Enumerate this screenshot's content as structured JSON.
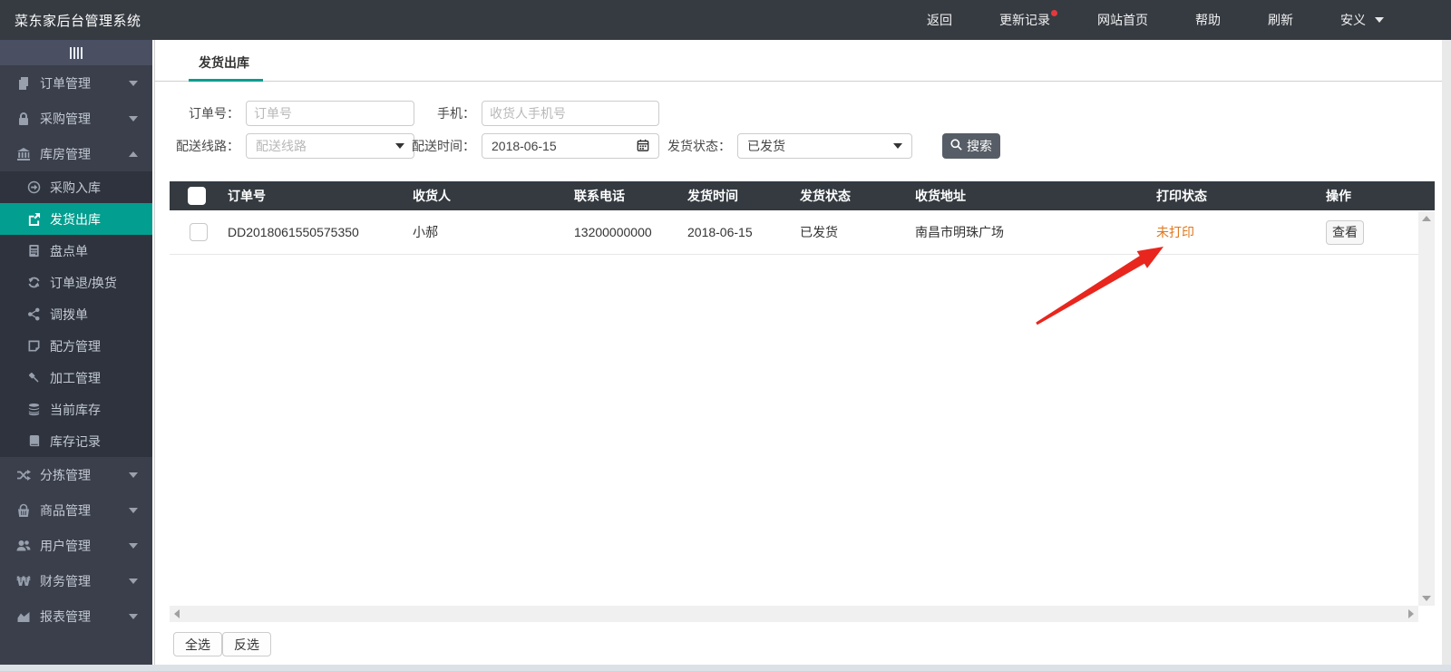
{
  "topbar": {
    "title": "菜东家后台管理系统",
    "nav": {
      "back": "返回",
      "updates": "更新记录",
      "site_home": "网站首页",
      "help": "帮助",
      "refresh": "刷新",
      "user": "安义"
    }
  },
  "sidebar": {
    "items": [
      {
        "label": "订单管理",
        "icon": "files-icon",
        "expanded": false
      },
      {
        "label": "采购管理",
        "icon": "lock-icon",
        "expanded": false
      },
      {
        "label": "库房管理",
        "icon": "bank-icon",
        "expanded": true,
        "children": [
          {
            "label": "采购入库",
            "icon": "sign-in-icon",
            "active": false
          },
          {
            "label": "发货出库",
            "icon": "export-icon",
            "active": true
          },
          {
            "label": "盘点单",
            "icon": "calculator-icon",
            "active": false
          },
          {
            "label": "订单退/换货",
            "icon": "refresh-icon",
            "active": false
          },
          {
            "label": "调拨单",
            "icon": "share-icon",
            "active": false
          },
          {
            "label": "配方管理",
            "icon": "note-icon",
            "active": false
          },
          {
            "label": "加工管理",
            "icon": "gavel-icon",
            "active": false
          },
          {
            "label": "当前库存",
            "icon": "database-icon",
            "active": false
          },
          {
            "label": "库存记录",
            "icon": "book-icon",
            "active": false
          }
        ]
      },
      {
        "label": "分拣管理",
        "icon": "shuffle-icon",
        "expanded": false
      },
      {
        "label": "商品管理",
        "icon": "basket-icon",
        "expanded": false
      },
      {
        "label": "用户管理",
        "icon": "users-icon",
        "expanded": false
      },
      {
        "label": "财务管理",
        "icon": "won-icon",
        "expanded": false
      },
      {
        "label": "报表管理",
        "icon": "area-chart-icon",
        "expanded": false
      }
    ]
  },
  "tabs": {
    "active": "发货出库"
  },
  "filters": {
    "order_no_label": "订单号：",
    "order_no_placeholder": "订单号",
    "phone_label": "手机：",
    "phone_placeholder": "收货人手机号",
    "route_label": "配送线路：",
    "route_value": "配送线路",
    "date_label": "配送时间：",
    "date_value": "2018-06-15",
    "status_label": "发货状态：",
    "status_value": "已发货",
    "search_label": "搜索"
  },
  "table": {
    "headers": [
      "订单号",
      "收货人",
      "联系电话",
      "发货时间",
      "发货状态",
      "收货地址",
      "打印状态",
      "操作"
    ],
    "row": {
      "order_no": "DD2018061550575350",
      "receiver": "小郝",
      "phone": "13200000000",
      "ship_time": "2018-06-15",
      "ship_status": "已发货",
      "address": "南昌市明珠广场",
      "print_status": "未打印",
      "action": "查看"
    }
  },
  "footer": {
    "select_all": "全选",
    "invert_select": "反选"
  },
  "colors": {
    "accent_green": "#029e8f",
    "print_orange": "#e0761a",
    "arrow_red": "#e8261d",
    "badge_red": "#e4393c",
    "header_dark": "#343a40"
  }
}
